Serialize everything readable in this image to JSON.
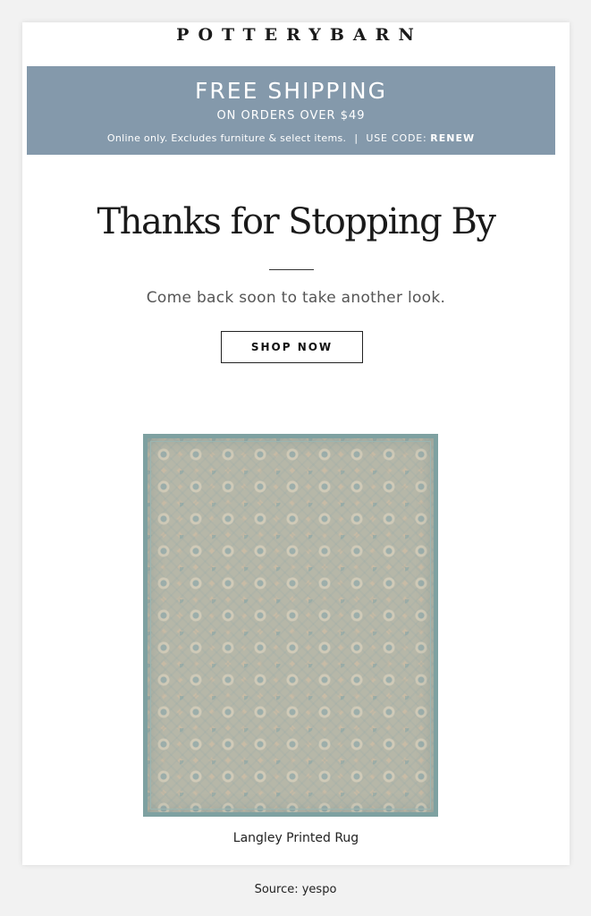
{
  "brand": {
    "logo_text": "POTTERYBARN"
  },
  "promo": {
    "headline": "FREE SHIPPING",
    "subline": "ON ORDERS OVER $49",
    "terms": "Online only. Excludes furniture & select items.",
    "divider": "|",
    "code_label": "USE CODE:",
    "code_value": "RENEW",
    "background_color": "#8499ab"
  },
  "hero": {
    "title": "Thanks for Stopping By",
    "subtitle": "Come back soon to take another look.",
    "cta_label": "SHOP NOW"
  },
  "product": {
    "caption": "Langley Printed Rug",
    "image_alt": "rug-image"
  },
  "footer": {
    "source": "Source: yespo"
  }
}
